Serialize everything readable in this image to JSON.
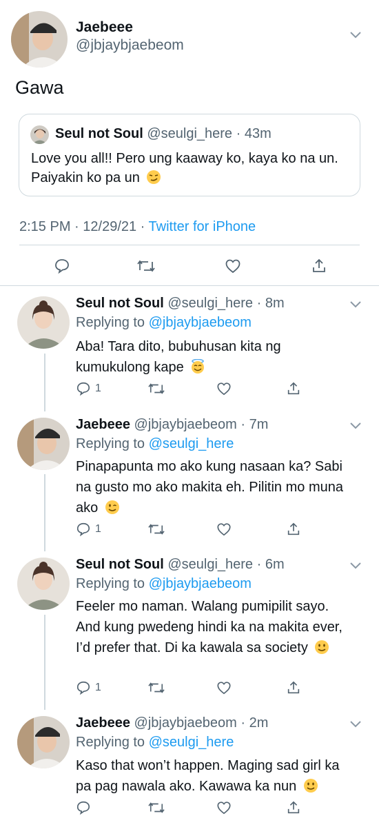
{
  "main_tweet": {
    "name": "Jaebeee",
    "handle": "@jbjaybjaebeom",
    "text": "Gawa",
    "quote": {
      "name": "Seul not Soul",
      "handle": "@seulgi_here",
      "time": "43m",
      "text": "Love you all!! Pero ung kaaway ko, kaya ko na un. Paiyakin ko pa un",
      "emoji": "smirk-emoji"
    },
    "time": "2:15 PM",
    "date": "12/29/21",
    "source": "Twitter for iPhone"
  },
  "replies": [
    {
      "name": "Seul not Soul",
      "handle": "@seulgi_here",
      "time": "8m",
      "replying_label": "Replying to",
      "replying_to": "@jbjaybjaebeom",
      "text": "Aba! Tara dito, bubuhusan kita ng kumukulong kape",
      "emoji": "halo-emoji",
      "reply_count": "1"
    },
    {
      "name": "Jaebeee",
      "handle": "@jbjaybjaebeom",
      "time": "7m",
      "replying_label": "Replying to",
      "replying_to": "@seulgi_here",
      "text": "Pinapapunta mo ako kung nasaan ka? Sabi na gusto mo ako makita eh. Pilitin mo muna ako",
      "emoji": "wink-emoji",
      "reply_count": "1"
    },
    {
      "name": "Seul not Soul",
      "handle": "@seulgi_here",
      "time": "6m",
      "replying_label": "Replying to",
      "replying_to": "@jbjaybjaebeom",
      "text": "Feeler mo naman. Walang pumipilit sayo. And kung pwedeng hindi ka na makita ever, I’d prefer that. Di ka kawala sa society",
      "emoji": "smile-emoji",
      "reply_count": "1"
    },
    {
      "name": "Jaebeee",
      "handle": "@jbjaybjaebeom",
      "time": "2m",
      "replying_label": "Replying to",
      "replying_to": "@seulgi_here",
      "text": "Kaso that won’t happen. Maging sad girl ka pa pag nawala ako. Kawawa ka nun",
      "emoji": "smile-emoji",
      "reply_count": ""
    }
  ],
  "separator": " · ",
  "colors": {
    "link": "#1d9bf0",
    "secondary": "#536471",
    "divider": "#cfd9de",
    "emoji": "#ffcc4d"
  }
}
